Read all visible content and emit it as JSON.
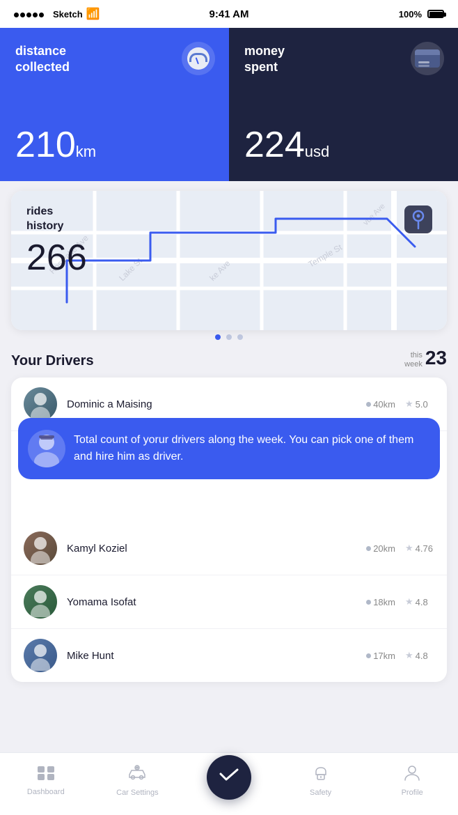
{
  "statusBar": {
    "app": "Sketch",
    "time": "9:41 AM",
    "battery": "100%"
  },
  "cards": {
    "distance": {
      "label": "distance\ncollected",
      "value": "210",
      "unit": "km"
    },
    "money": {
      "label": "money\nspent",
      "value": "224",
      "unit": "usd"
    },
    "rides": {
      "label": "rides\nhistory",
      "value": "266"
    }
  },
  "pagination": {
    "total": 3,
    "active": 0
  },
  "driversSection": {
    "title": "Your Drivers",
    "thisWeekLabel": "this\nweek",
    "count": "23"
  },
  "tooltip": {
    "text": "Total count of yorur drivers along the week. You can pick one of them and hire him as driver."
  },
  "drivers": [
    {
      "name": "Dominic a Maising",
      "distance": "40km",
      "rating": "5.0"
    },
    {
      "name": "Kamyl Koziel",
      "distance": "20km",
      "rating": "4.76"
    },
    {
      "name": "Yomama Isofat",
      "distance": "18km",
      "rating": "4.8"
    },
    {
      "name": "Mike Hunt",
      "distance": "17km",
      "rating": "4.8"
    }
  ],
  "bottomNav": {
    "items": [
      {
        "id": "dashboard",
        "label": "Dashboard"
      },
      {
        "id": "car-settings",
        "label": "Car Settings"
      },
      {
        "id": "center",
        "label": ""
      },
      {
        "id": "safety",
        "label": "Safety"
      },
      {
        "id": "profile",
        "label": "Profile"
      }
    ]
  }
}
